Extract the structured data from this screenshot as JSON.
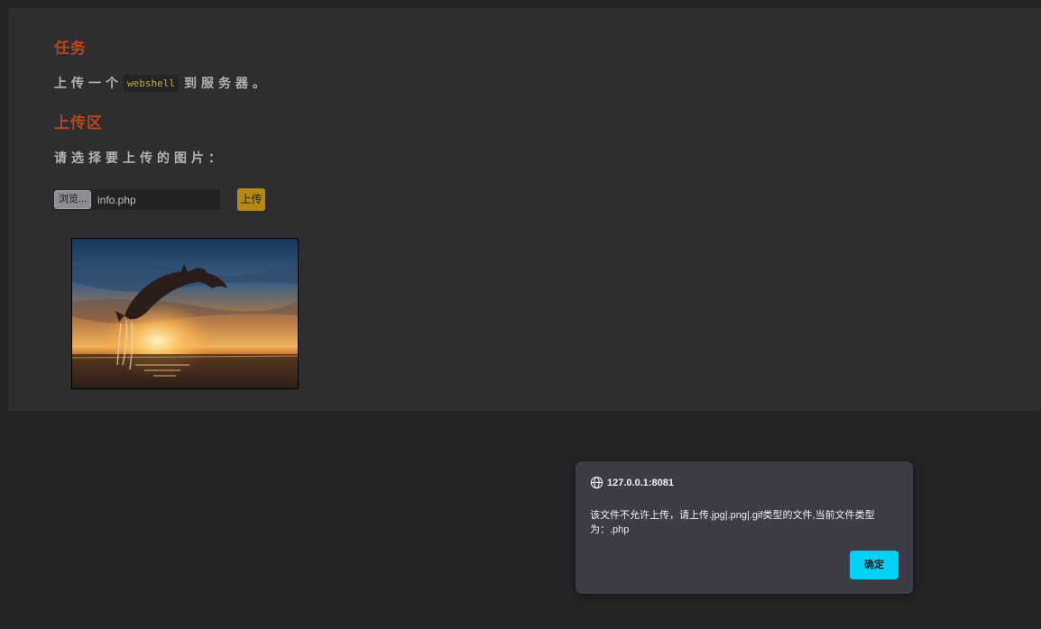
{
  "task": {
    "title": "任务",
    "text_before": "上传一个",
    "code": "webshell",
    "text_after": "到服务器。"
  },
  "upload_area": {
    "title": "上传区",
    "prompt": "请选择要上传的图片：",
    "browse_label": "浏览...",
    "file_name": "info.php",
    "upload_label": "上传"
  },
  "dialog": {
    "origin": "127.0.0.1:8081",
    "message": "该文件不允许上传，请上传.jpg|.png|.gif类型的文件,当前文件类型为：.php",
    "ok_label": "确定"
  },
  "colors": {
    "page_bg": "#242426",
    "panel_bg": "#2e2e31",
    "heading": "#b5481e",
    "upload_button": "#b48a11",
    "dialog_bg": "#3d3b46",
    "ok_button": "#00d2f5"
  },
  "icons": {
    "dialog_origin": "globe-icon"
  }
}
